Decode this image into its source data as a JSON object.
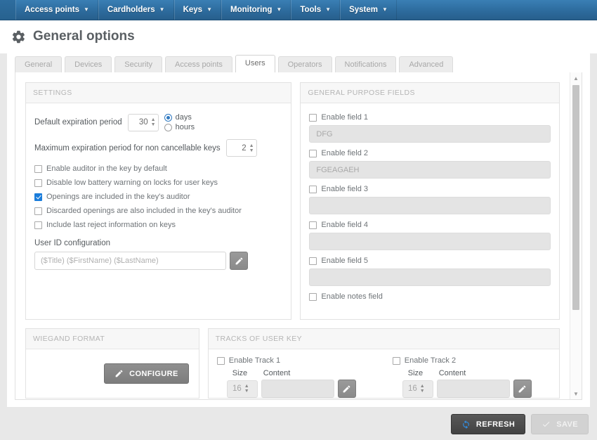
{
  "navbar": {
    "items": [
      {
        "label": "Access points",
        "caret": "chevron-down-icon"
      },
      {
        "label": "Cardholders",
        "caret": "chevron-down-icon"
      },
      {
        "label": "Keys",
        "caret": "chevron-down-icon"
      },
      {
        "label": "Monitoring",
        "caret": "chevron-down-icon"
      },
      {
        "label": "Tools",
        "caret": "chevron-down-icon"
      },
      {
        "label": "System",
        "caret": "chevron-down-icon"
      }
    ]
  },
  "page": {
    "title": "General options",
    "icon": "gear-icon"
  },
  "tabs": [
    {
      "label": "General",
      "active": false
    },
    {
      "label": "Devices",
      "active": false
    },
    {
      "label": "Security",
      "active": false
    },
    {
      "label": "Access points",
      "active": false
    },
    {
      "label": "Users",
      "active": true
    },
    {
      "label": "Operators",
      "active": false
    },
    {
      "label": "Notifications",
      "active": false
    },
    {
      "label": "Advanced",
      "active": false
    }
  ],
  "settings": {
    "title": "SETTINGS",
    "default_expiration_label": "Default expiration period",
    "default_expiration_value": "30",
    "unit_days": "days",
    "unit_hours": "hours",
    "unit_selected": "days",
    "max_expiration_label": "Maximum expiration period for non cancellable keys",
    "max_expiration_value": "2",
    "checkboxes": [
      {
        "label": "Enable auditor in the key by default",
        "checked": false
      },
      {
        "label": "Disable low battery warning on locks for user keys",
        "checked": false
      },
      {
        "label": "Openings are included in the key's auditor",
        "checked": true
      },
      {
        "label": "Discarded openings are also included in the key's auditor",
        "checked": false
      },
      {
        "label": "Include last reject information on keys",
        "checked": false
      }
    ],
    "user_id_label": "User ID configuration",
    "user_id_placeholder": "($Title) ($FirstName) ($LastName)",
    "user_id_value": "",
    "edit_icon": "pencil-icon"
  },
  "general_purpose_fields": {
    "title": "GENERAL PURPOSE FIELDS",
    "fields": [
      {
        "label": "Enable field 1",
        "checked": false,
        "value": "DFG"
      },
      {
        "label": "Enable field 2",
        "checked": false,
        "value": "FGEAGAEH"
      },
      {
        "label": "Enable field 3",
        "checked": false,
        "value": ""
      },
      {
        "label": "Enable field 4",
        "checked": false,
        "value": ""
      },
      {
        "label": "Enable field 5",
        "checked": false,
        "value": ""
      }
    ],
    "notes_label": "Enable notes field",
    "notes_checked": false
  },
  "wiegand": {
    "title": "WIEGAND FORMAT",
    "configure_label": "CONFIGURE",
    "configure_icon": "pencil-icon"
  },
  "tracks": {
    "title": "TRACKS OF USER KEY",
    "columns": [
      {
        "enable_label": "Enable Track 1",
        "enabled": false,
        "size_header": "Size",
        "content_header": "Content",
        "size_value": "16",
        "content_value": "",
        "edit_icon": "pencil-icon"
      },
      {
        "enable_label": "Enable Track 2",
        "enabled": false,
        "size_header": "Size",
        "content_header": "Content",
        "size_value": "16",
        "content_value": "",
        "edit_icon": "pencil-icon"
      }
    ]
  },
  "footer": {
    "refresh_label": "REFRESH",
    "refresh_icon": "refresh-icon",
    "save_label": "SAVE",
    "save_icon": "check-icon",
    "save_disabled": true
  },
  "scrollbar": {
    "up_icon": "caret-up-icon",
    "down_icon": "caret-down-icon"
  },
  "colors": {
    "navbar": "#2e6d9f",
    "accent": "#1b7ddb",
    "radio_accent": "#2f79c0",
    "page_bg": "#e8e8e8",
    "refresh_btn": "#424242"
  }
}
